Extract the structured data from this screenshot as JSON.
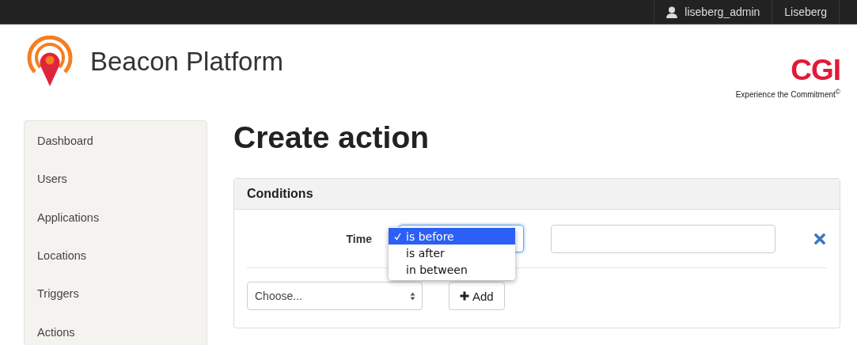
{
  "navbar": {
    "user": "liseberg_admin",
    "organization": "Liseberg"
  },
  "brand": {
    "title": "Beacon Platform"
  },
  "partner_logo": {
    "text": "CGI",
    "tagline": "Experience the Commitment$^{©}$"
  },
  "sidebar": {
    "items": [
      {
        "label": "Dashboard"
      },
      {
        "label": "Users"
      },
      {
        "label": "Applications"
      },
      {
        "label": "Locations"
      },
      {
        "label": "Triggers"
      },
      {
        "label": "Actions"
      }
    ]
  },
  "page_title": "Create action",
  "conditions": {
    "heading": "Conditions",
    "rows": [
      {
        "label": "Time",
        "operator": {
          "expanded": true,
          "options": [
            {
              "label": "is before",
              "selected": true
            },
            {
              "label": "is after",
              "selected": false
            },
            {
              "label": "in between",
              "selected": false
            }
          ]
        }
      }
    ],
    "add": {
      "select": "Choose...",
      "button": "Add"
    }
  }
}
